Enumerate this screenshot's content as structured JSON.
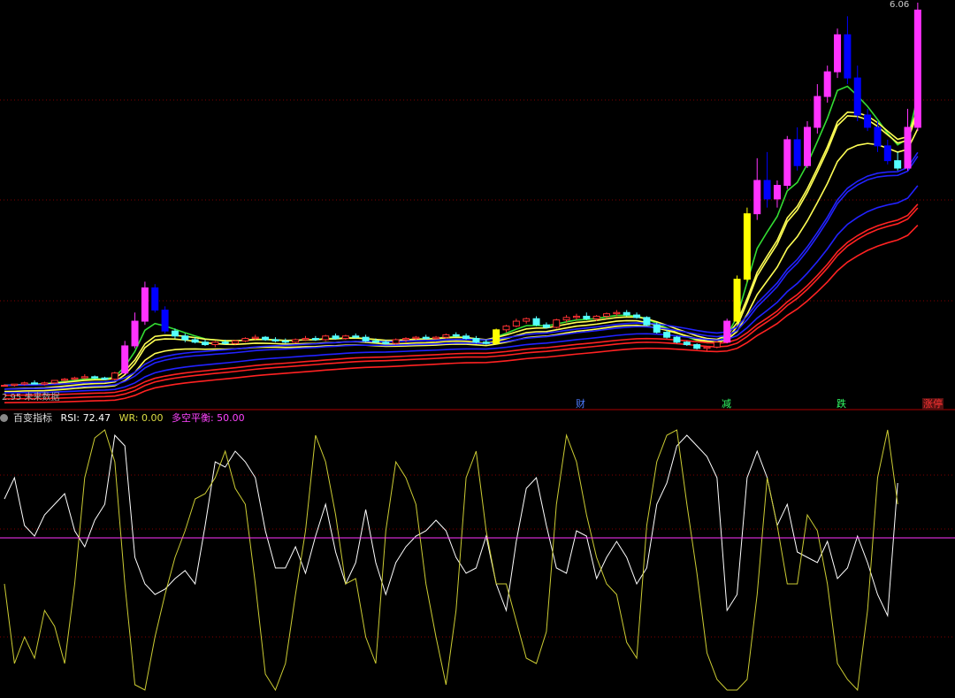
{
  "top_price_label": "6.06",
  "bottom_left_label": "2.95",
  "bottom_left_text": "未来数据",
  "indicator": {
    "name": "百变指标",
    "rsi_label": "RSI: 72.47",
    "wr_label": "WR: 0.00",
    "balance_label": "多空平衡: 50.00"
  },
  "events": [
    {
      "label": "财",
      "x_index": 55,
      "color": "#4d7bff"
    },
    {
      "label": "减",
      "x_index": 69,
      "color": "#33ff66"
    },
    {
      "label": "跌",
      "x_index": 80,
      "color": "#33ff66"
    },
    {
      "label": "涨停",
      "x_index": 89,
      "color": "#ff3333"
    }
  ],
  "colors": {
    "up": "#ff3333",
    "down": "#55ffff",
    "highlight_up": "#ff33ff",
    "highlight_down": "#0000ff",
    "yellow": "#ffff00",
    "ma_green": "#33dd33",
    "ma_yellow": "#ffff55",
    "ma_blue": "#2222ff",
    "ma_red": "#ff2222",
    "rsi_line": "#ffffff",
    "wr_line": "#cccc33",
    "balance_line": "#ff33ff",
    "grid": "#800000"
  },
  "chart_data": [
    {
      "type": "candlestick",
      "title": "",
      "ylim": [
        2.95,
        6.06
      ],
      "candles": [
        [
          2.96,
          2.97,
          2.95,
          2.96
        ],
        [
          2.96,
          2.97,
          2.95,
          2.97
        ],
        [
          2.97,
          2.99,
          2.96,
          2.98
        ],
        [
          2.98,
          3.0,
          2.97,
          2.97
        ],
        [
          2.97,
          2.99,
          2.96,
          2.98
        ],
        [
          2.98,
          3.0,
          2.97,
          3.0
        ],
        [
          3.0,
          3.02,
          2.99,
          3.01
        ],
        [
          3.01,
          3.03,
          3.0,
          3.02
        ],
        [
          3.02,
          3.05,
          3.01,
          3.03
        ],
        [
          3.03,
          3.04,
          3.01,
          3.02
        ],
        [
          3.02,
          3.03,
          3.0,
          3.01
        ],
        [
          3.01,
          3.07,
          3.0,
          3.06
        ],
        [
          3.06,
          3.32,
          3.05,
          3.28
        ],
        [
          3.28,
          3.55,
          3.26,
          3.48
        ],
        [
          3.48,
          3.8,
          3.45,
          3.75
        ],
        [
          3.75,
          3.78,
          3.55,
          3.57
        ],
        [
          3.57,
          3.6,
          3.38,
          3.4
        ],
        [
          3.4,
          3.42,
          3.34,
          3.36
        ],
        [
          3.36,
          3.38,
          3.31,
          3.33
        ],
        [
          3.33,
          3.35,
          3.3,
          3.31
        ],
        [
          3.31,
          3.33,
          3.28,
          3.29
        ],
        [
          3.29,
          3.32,
          3.27,
          3.31
        ],
        [
          3.31,
          3.33,
          3.29,
          3.3
        ],
        [
          3.3,
          3.33,
          3.29,
          3.32
        ],
        [
          3.32,
          3.35,
          3.31,
          3.34
        ],
        [
          3.34,
          3.37,
          3.33,
          3.35
        ],
        [
          3.35,
          3.36,
          3.32,
          3.33
        ],
        [
          3.33,
          3.35,
          3.31,
          3.32
        ],
        [
          3.32,
          3.34,
          3.3,
          3.31
        ],
        [
          3.31,
          3.34,
          3.3,
          3.33
        ],
        [
          3.33,
          3.36,
          3.32,
          3.34
        ],
        [
          3.34,
          3.36,
          3.32,
          3.33
        ],
        [
          3.33,
          3.37,
          3.32,
          3.36
        ],
        [
          3.36,
          3.38,
          3.33,
          3.34
        ],
        [
          3.34,
          3.37,
          3.33,
          3.36
        ],
        [
          3.36,
          3.38,
          3.34,
          3.35
        ],
        [
          3.35,
          3.37,
          3.31,
          3.32
        ],
        [
          3.32,
          3.34,
          3.3,
          3.31
        ],
        [
          3.31,
          3.33,
          3.29,
          3.3
        ],
        [
          3.3,
          3.34,
          3.29,
          3.33
        ],
        [
          3.33,
          3.35,
          3.31,
          3.34
        ],
        [
          3.34,
          3.36,
          3.33,
          3.35
        ],
        [
          3.35,
          3.37,
          3.33,
          3.34
        ],
        [
          3.34,
          3.36,
          3.33,
          3.35
        ],
        [
          3.35,
          3.38,
          3.34,
          3.37
        ],
        [
          3.37,
          3.39,
          3.35,
          3.36
        ],
        [
          3.36,
          3.38,
          3.33,
          3.34
        ],
        [
          3.34,
          3.36,
          3.3,
          3.31
        ],
        [
          3.31,
          3.33,
          3.29,
          3.3
        ],
        [
          3.3,
          3.42,
          3.29,
          3.41
        ],
        [
          3.41,
          3.45,
          3.39,
          3.44
        ],
        [
          3.44,
          3.5,
          3.43,
          3.48
        ],
        [
          3.48,
          3.51,
          3.46,
          3.5
        ],
        [
          3.5,
          3.52,
          3.44,
          3.45
        ],
        [
          3.45,
          3.47,
          3.42,
          3.43
        ],
        [
          3.43,
          3.5,
          3.42,
          3.49
        ],
        [
          3.49,
          3.53,
          3.47,
          3.51
        ],
        [
          3.51,
          3.54,
          3.49,
          3.52
        ],
        [
          3.52,
          3.55,
          3.49,
          3.5
        ],
        [
          3.5,
          3.53,
          3.48,
          3.52
        ],
        [
          3.52,
          3.55,
          3.5,
          3.54
        ],
        [
          3.54,
          3.57,
          3.52,
          3.55
        ],
        [
          3.55,
          3.57,
          3.52,
          3.53
        ],
        [
          3.53,
          3.55,
          3.5,
          3.51
        ],
        [
          3.51,
          3.52,
          3.44,
          3.45
        ],
        [
          3.45,
          3.47,
          3.38,
          3.39
        ],
        [
          3.39,
          3.41,
          3.34,
          3.35
        ],
        [
          3.35,
          3.36,
          3.3,
          3.31
        ],
        [
          3.31,
          3.32,
          3.28,
          3.29
        ],
        [
          3.29,
          3.3,
          3.25,
          3.26
        ],
        [
          3.26,
          3.28,
          3.24,
          3.27
        ],
        [
          3.27,
          3.32,
          3.26,
          3.31
        ],
        [
          3.31,
          3.5,
          3.3,
          3.48
        ],
        [
          3.48,
          3.85,
          3.46,
          3.82
        ],
        [
          3.82,
          4.4,
          3.8,
          4.35
        ],
        [
          4.35,
          4.8,
          4.3,
          4.62
        ],
        [
          4.62,
          4.85,
          4.4,
          4.47
        ],
        [
          4.47,
          4.62,
          4.4,
          4.58
        ],
        [
          4.58,
          4.98,
          4.55,
          4.95
        ],
        [
          4.95,
          5.05,
          4.7,
          4.74
        ],
        [
          4.74,
          5.1,
          4.72,
          5.05
        ],
        [
          5.05,
          5.4,
          5.0,
          5.3
        ],
        [
          5.3,
          5.55,
          5.25,
          5.5
        ],
        [
          5.5,
          5.85,
          5.45,
          5.8
        ],
        [
          5.8,
          5.95,
          5.4,
          5.45
        ],
        [
          5.45,
          5.55,
          5.1,
          5.15
        ],
        [
          5.15,
          5.2,
          5.02,
          5.05
        ],
        [
          5.05,
          5.1,
          4.85,
          4.9
        ],
        [
          4.9,
          4.95,
          4.75,
          4.78
        ],
        [
          4.78,
          4.85,
          4.7,
          4.72
        ],
        [
          4.72,
          5.2,
          4.7,
          5.05
        ],
        [
          5.05,
          6.06,
          5.02,
          6.0
        ]
      ]
    },
    {
      "type": "line",
      "title": "",
      "ylim": [
        0,
        100
      ],
      "series": [
        {
          "name": "RSI",
          "values": [
            72,
            80,
            62,
            58,
            66,
            70,
            74,
            60,
            54,
            64,
            70,
            96,
            92,
            50,
            40,
            36,
            38,
            42,
            45,
            40,
            62,
            86,
            84,
            90,
            86,
            80,
            60,
            46,
            46,
            54,
            44,
            58,
            70,
            52,
            40,
            48,
            68,
            48,
            36,
            48,
            54,
            58,
            60,
            64,
            60,
            50,
            44,
            46,
            58,
            40,
            30,
            56,
            76,
            80,
            62,
            46,
            44,
            60,
            58,
            42,
            50,
            56,
            50,
            40,
            46,
            70,
            78,
            92,
            96,
            92,
            88,
            80,
            30,
            36,
            80,
            90,
            80,
            62,
            70,
            52,
            50,
            48,
            56,
            42,
            46,
            58,
            48,
            36,
            28,
            78
          ]
        },
        {
          "name": "WR",
          "values": [
            40,
            10,
            20,
            12,
            30,
            24,
            10,
            40,
            80,
            95,
            98,
            86,
            40,
            2,
            0,
            20,
            36,
            50,
            60,
            72,
            74,
            80,
            90,
            76,
            70,
            40,
            6,
            0,
            10,
            36,
            60,
            96,
            86,
            66,
            40,
            42,
            20,
            10,
            60,
            86,
            80,
            70,
            40,
            20,
            2,
            30,
            80,
            90,
            60,
            40,
            40,
            26,
            12,
            10,
            22,
            70,
            96,
            86,
            66,
            50,
            40,
            36,
            18,
            12,
            62,
            86,
            96,
            98,
            70,
            44,
            14,
            4,
            0,
            0,
            4,
            36,
            80,
            62,
            40,
            40,
            66,
            60,
            40,
            10,
            4,
            0,
            30,
            80,
            98,
            70
          ]
        },
        {
          "name": "多空平衡",
          "values": [
            50
          ]
        }
      ]
    }
  ]
}
